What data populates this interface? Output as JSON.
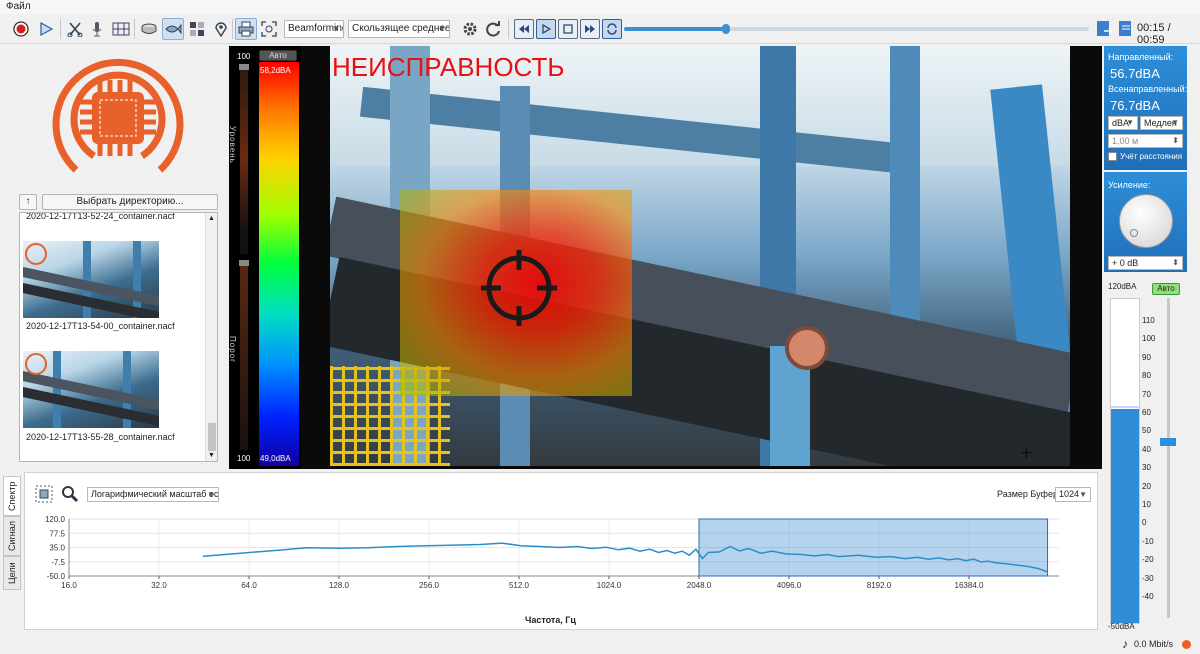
{
  "menu": {
    "file": "Файл"
  },
  "toolbar": {
    "mode_select": "Beamforming",
    "avg_select": "Скользящее среднее",
    "time_readout": "00:15 / 00:59",
    "playback_progress": 0.22
  },
  "left": {
    "choose_dir": "Выбрать директорию...",
    "up_arrow": "↑",
    "files": [
      "2020-12-17T13-52-24_container.nacf",
      "2020-12-17T13-54-00_container.nacf",
      "2020-12-17T13-55-28_container.nacf"
    ]
  },
  "view": {
    "auto_label": "Авто",
    "scale_top": "100",
    "scale_bottom": "100",
    "level_label": "Уровень",
    "threshold_label": "Порог",
    "db_top": "58,2dBA",
    "db_bottom": "49,0dBA",
    "alert": "НЕИСПРАВНОСТЬ"
  },
  "right": {
    "directional_label": "Направленный:",
    "directional_value": "56.7dBA",
    "omni_label": "Всенаправленный:",
    "omni_value": "76.7dBA",
    "unit_select": "dBA",
    "speed_select": "Медлен",
    "distance_value": "1,00 м",
    "distance_check": "Учёт расстояния",
    "gain_label": "Усиление:",
    "gain_value": "+ 0 dB",
    "meter_top": "120dBA",
    "meter_bottom": "-50dBA",
    "auto_btn": "Авто",
    "meter_ticks": [
      "110",
      "100",
      "90",
      "80",
      "70",
      "60",
      "50",
      "40",
      "30",
      "20",
      "10",
      "0",
      "-10",
      "-20",
      "-30",
      "-40"
    ]
  },
  "spectrum": {
    "tab_spectrum": "Спектр",
    "tab_signal": "Сигнал",
    "tab_targets": "Цели",
    "scale_select": "Логарифмический масштаб оси X",
    "buffer_label": "Размер Буфера:",
    "buffer_value": "1024",
    "xlabel": "Частота, Гц"
  },
  "chart_data": {
    "type": "line",
    "xlabel": "Частота, Гц",
    "ylabel": "",
    "x_scale": "log2",
    "xlim": [
      16,
      32768
    ],
    "ylim": [
      -50,
      120
    ],
    "xticks": [
      "16.0",
      "32.0",
      "64.0",
      "128.0",
      "256.0",
      "512.0",
      "1024.0",
      "2048.0",
      "4096.0",
      "8192.0",
      "16384.0"
    ],
    "yticks": [
      "120.0",
      "77.5",
      "35.0",
      "-7.5",
      "-50.0"
    ],
    "selection": [
      2048,
      30000
    ],
    "series": [
      {
        "x": [
          45,
          60,
          80,
          100,
          130,
          160,
          200,
          250,
          300,
          380,
          450,
          520,
          600,
          700,
          800,
          900,
          1000,
          1100,
          1200,
          1300,
          1400,
          1500,
          1600,
          1700,
          1800,
          1900,
          2000,
          2100,
          2200,
          2400,
          2600,
          2800,
          3000,
          3300,
          3600,
          4000,
          4500,
          5000,
          5500,
          6000,
          7000,
          8000,
          9000,
          10000,
          11000,
          12000,
          13000,
          14000,
          15000,
          16000,
          17000,
          18000,
          19000,
          20000,
          22000,
          24000,
          26000,
          28000,
          30000
        ],
        "y": [
          9,
          18,
          27,
          34,
          33,
          34,
          38,
          40,
          42,
          44,
          48,
          40,
          38,
          35,
          38,
          32,
          36,
          28,
          33,
          24,
          30,
          20,
          26,
          18,
          24,
          12,
          30,
          2,
          20,
          22,
          38,
          25,
          32,
          18,
          24,
          16,
          14,
          10,
          14,
          8,
          12,
          6,
          8,
          2,
          6,
          0,
          4,
          -2,
          2,
          -4,
          0,
          -8,
          -6,
          -10,
          -14,
          -18,
          -22,
          -28,
          -38
        ]
      }
    ]
  }
}
